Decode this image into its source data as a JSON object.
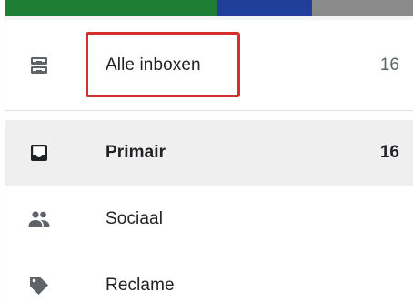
{
  "colors": {
    "bar_green": "#1e7e34",
    "bar_blue": "#1f3f9a",
    "bar_gray": "#8a8a8a",
    "highlight": "#d32f2f",
    "selected_bg": "#efefef",
    "icon": "#5f6368"
  },
  "menu": {
    "all_inboxes": {
      "label": "Alle inboxen",
      "count": "16",
      "icon": "all-inboxes-icon"
    },
    "items": [
      {
        "label": "Primair",
        "count": "16",
        "icon": "inbox-icon",
        "selected": true
      },
      {
        "label": "Sociaal",
        "count": "",
        "icon": "people-icon"
      },
      {
        "label": "Reclame",
        "count": "",
        "icon": "tag-icon"
      }
    ]
  }
}
